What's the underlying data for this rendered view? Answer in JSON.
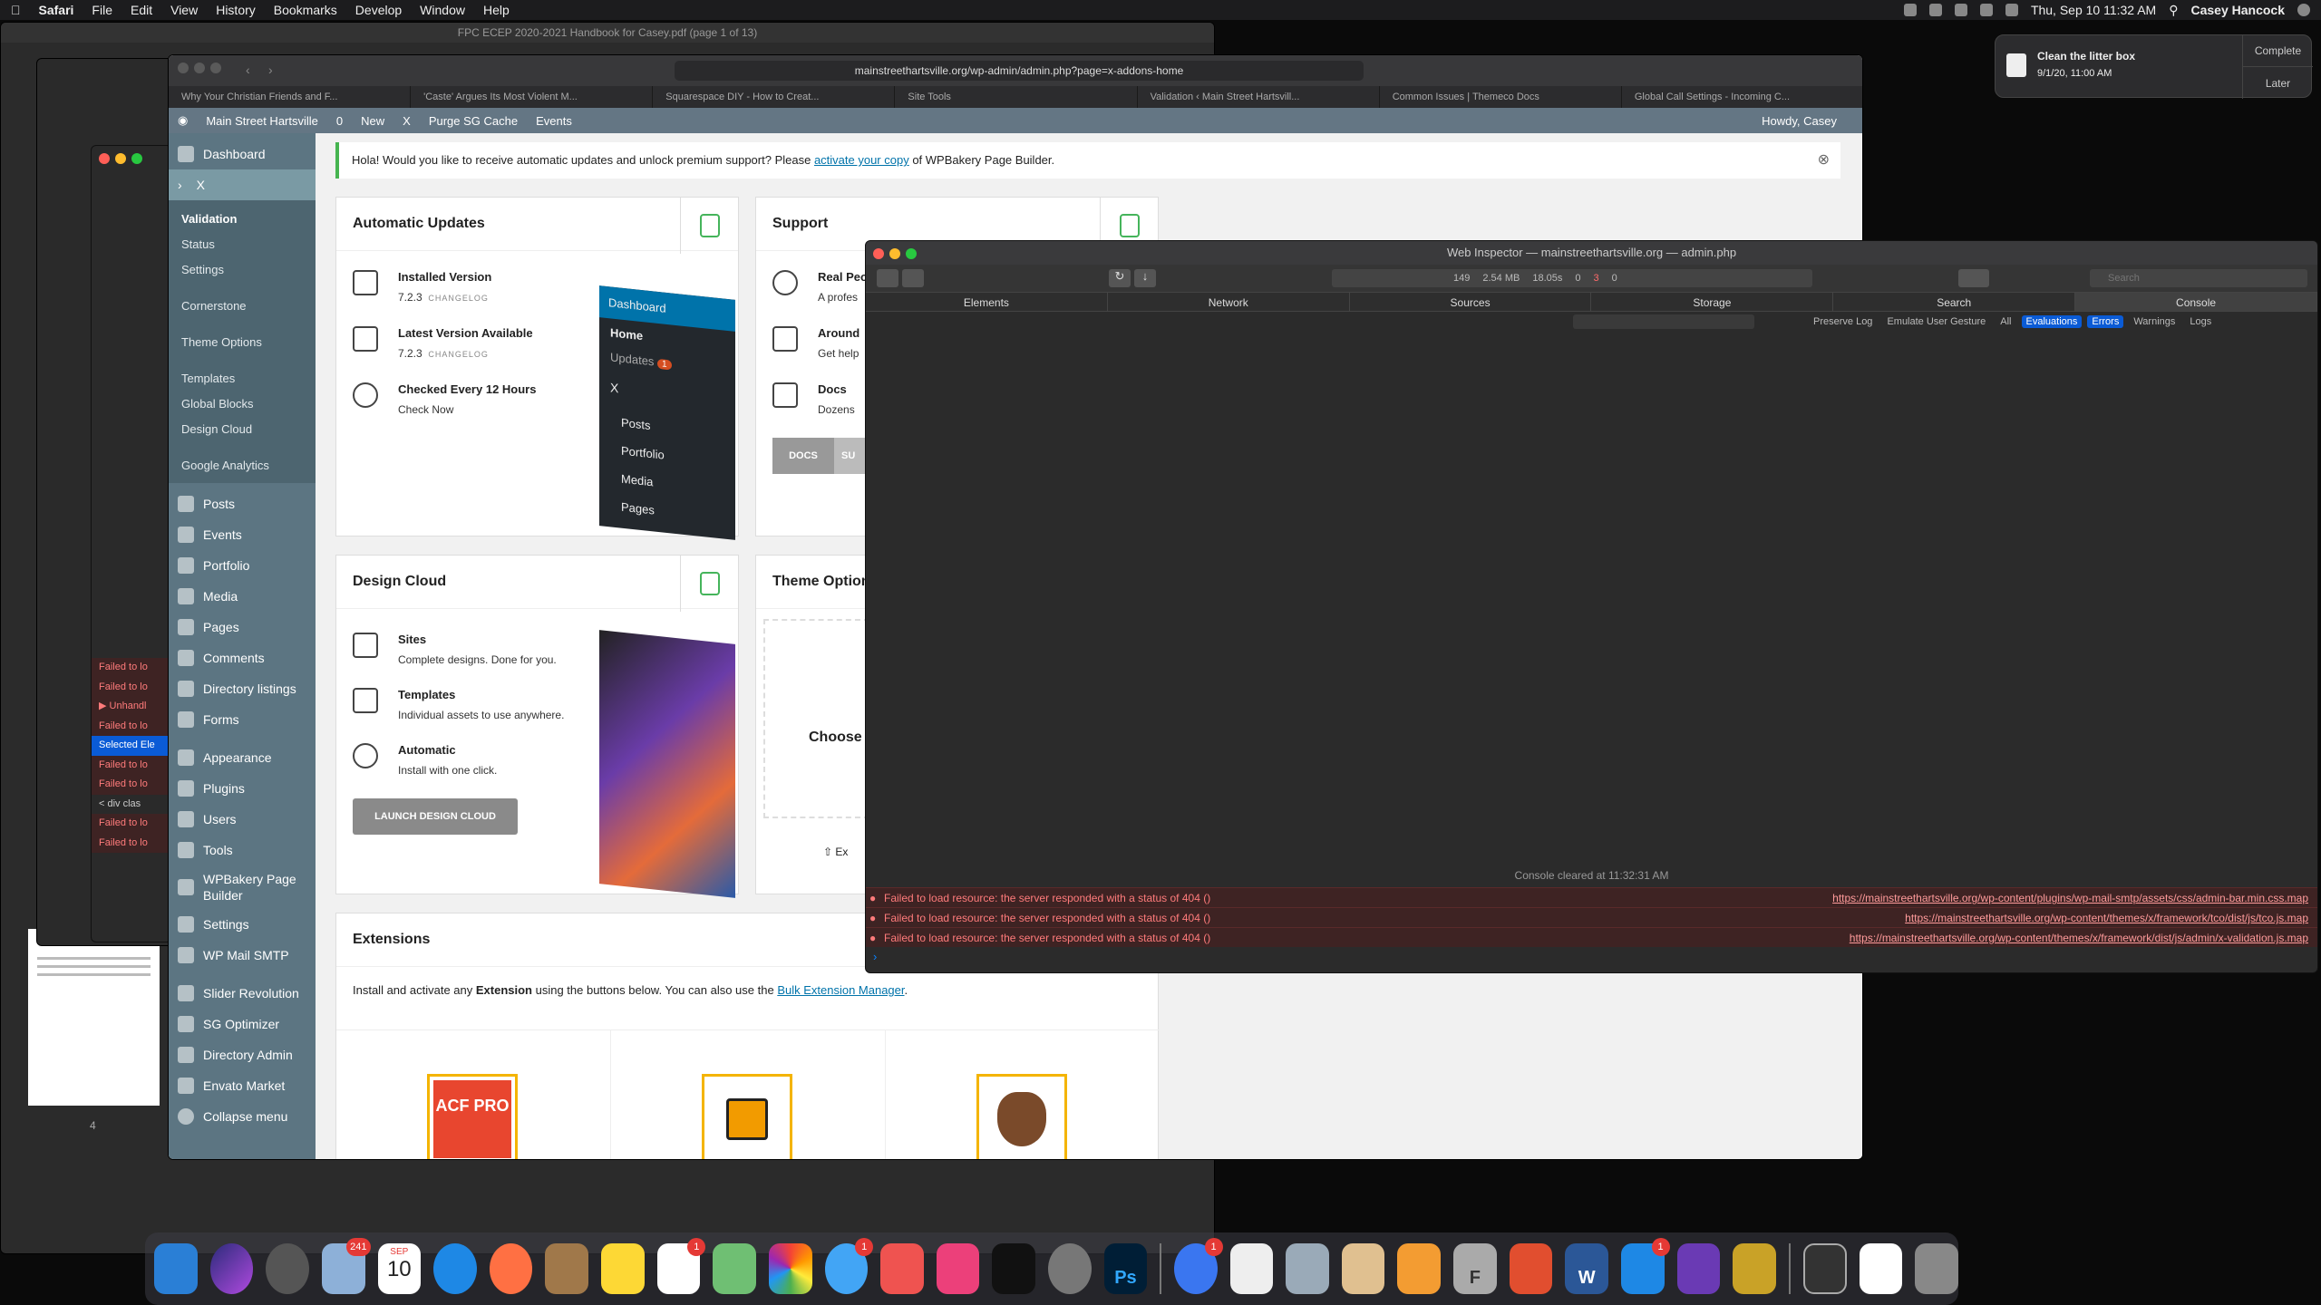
{
  "menubar": {
    "items": [
      "Safari",
      "File",
      "Edit",
      "View",
      "History",
      "Bookmarks",
      "Develop",
      "Window",
      "Help"
    ],
    "clock": "Thu, Sep 10  11:32 AM",
    "user": "Casey Hancock"
  },
  "notification": {
    "title": "Clean the litter box",
    "time": "9/1/20, 11:00 AM",
    "complete": "Complete",
    "later": "Later"
  },
  "pdf_window_title": "FPC ECEP 2020-2021 Handbook for Casey.pdf (page 1 of 13)",
  "pdf_page_number": "4",
  "safari": {
    "url": "mainstreethartsville.org/wp-admin/admin.php?page=x-addons-home",
    "tabs": [
      "Why Your Christian Friends and F...",
      "'Caste' Argues Its Most Violent M...",
      "Squarespace DIY - How to Creat...",
      "Site Tools",
      "Validation ‹ Main Street Hartsvill...",
      "Common Issues | Themeco Docs",
      "Global Call Settings - Incoming C..."
    ]
  },
  "adminbar": {
    "site": "Main Street Hartsville",
    "comments": "0",
    "new": "New",
    "x": "X",
    "purge": "Purge SG Cache",
    "events": "Events",
    "howdy": "Howdy, Casey"
  },
  "sidebar": {
    "dashboard": "Dashboard",
    "x": "X",
    "sub": [
      "Validation",
      "Status",
      "Settings",
      "Cornerstone",
      "Theme Options",
      "Templates",
      "Global Blocks",
      "Design Cloud",
      "Google Analytics"
    ],
    "menu": [
      "Posts",
      "Events",
      "Portfolio",
      "Media",
      "Pages",
      "Comments",
      "Directory listings",
      "Forms",
      "Appearance",
      "Plugins",
      "Users",
      "Tools",
      "WPBakery Page Builder",
      "Settings",
      "WP Mail SMTP",
      "Slider Revolution",
      "SG Optimizer",
      "Directory Admin",
      "Envato Market",
      "Collapse menu"
    ]
  },
  "notice": {
    "pre": "Hola! Would you like to receive automatic updates and unlock premium support? Please ",
    "link": "activate your copy",
    "post": " of WPBakery Page Builder."
  },
  "updates": {
    "title": "Automatic Updates",
    "installed": "Installed Version",
    "installed_ver": "7.2.3",
    "changelog": "CHANGELOG",
    "latest": "Latest Version Available",
    "latest_ver": "7.2.3",
    "checked": "Checked Every 12 Hours",
    "check_now": "Check Now",
    "preview": {
      "dashboard": "Dashboard",
      "home": "Home",
      "updates": "Updates",
      "badge": "1",
      "x": "X",
      "posts": "Posts",
      "portfolio": "Portfolio",
      "media": "Media",
      "pages": "Pages"
    }
  },
  "support": {
    "title": "Support",
    "rows": [
      [
        "Real Peo",
        "A profes"
      ],
      [
        "Around",
        "Get help"
      ],
      [
        "Docs",
        "Dozens"
      ]
    ],
    "docs_btn": "DOCS",
    "su_btn": "SU"
  },
  "design_cloud": {
    "title": "Design Cloud",
    "rows": [
      [
        "Sites",
        "Complete designs. Done for you."
      ],
      [
        "Templates",
        "Individual assets to use anywhere."
      ],
      [
        "Automatic",
        "Install with one click."
      ]
    ],
    "button": "LAUNCH DESIGN CLOUD"
  },
  "theme_options": {
    "title": "Theme Option",
    "choose": "Choose a",
    "ex": "Ex"
  },
  "extensions": {
    "title": "Extensions",
    "text_pre": "Install and activate any ",
    "text_bold": "Extension",
    "text_mid": " using the buttons below. You can also use the ",
    "link": "Bulk Extension Manager",
    "text_post": ".",
    "acf": "ACF PRO"
  },
  "inspector": {
    "title": "Web Inspector — mainstreethartsville.org — admin.php",
    "stats": [
      "149",
      "2.54 MB",
      "18.05s",
      "0",
      "3",
      "0"
    ],
    "search_placeholder": "Search",
    "tabs": [
      "Elements",
      "Network",
      "Sources",
      "Storage",
      "Search",
      "Console"
    ],
    "filter_labels": [
      "Preserve Log",
      "Emulate User Gesture",
      "All",
      "Evaluations",
      "Errors",
      "Warnings",
      "Logs"
    ],
    "cleared": "Console cleared at 11:32:31 AM",
    "errors": [
      {
        "msg": "Failed to load resource: the server responded with a status of 404 ()",
        "url": "https://mainstreethartsville.org/wp-content/plugins/wp-mail-smtp/assets/css/admin-bar.min.css.map"
      },
      {
        "msg": "Failed to load resource: the server responded with a status of 404 ()",
        "url": "https://mainstreethartsville.org/wp-content/themes/x/framework/tco/dist/js/tco.js.map"
      },
      {
        "msg": "Failed to load resource: the server responded with a status of 404 ()",
        "url": "https://mainstreethartsville.org/wp-content/themes/x/framework/dist/js/admin/x-validation.js.map"
      }
    ]
  },
  "left_console": {
    "lines": [
      "Failed to lo",
      "Failed to lo",
      "▶ Unhandl",
      "Failed to lo",
      "Selected Ele",
      "Failed to lo",
      "Failed to lo",
      "< div clas",
      "Failed to lo",
      "Failed to lo"
    ]
  },
  "dock": {
    "badges": {
      "photos": "241",
      "calendar_month": "SEP",
      "calendar_day": "10",
      "reminders": "1",
      "messages": "1",
      "signal": "1",
      "appstore": "1"
    },
    "letters": {
      "ps": "Ps",
      "word": "W",
      "font": "F"
    }
  }
}
